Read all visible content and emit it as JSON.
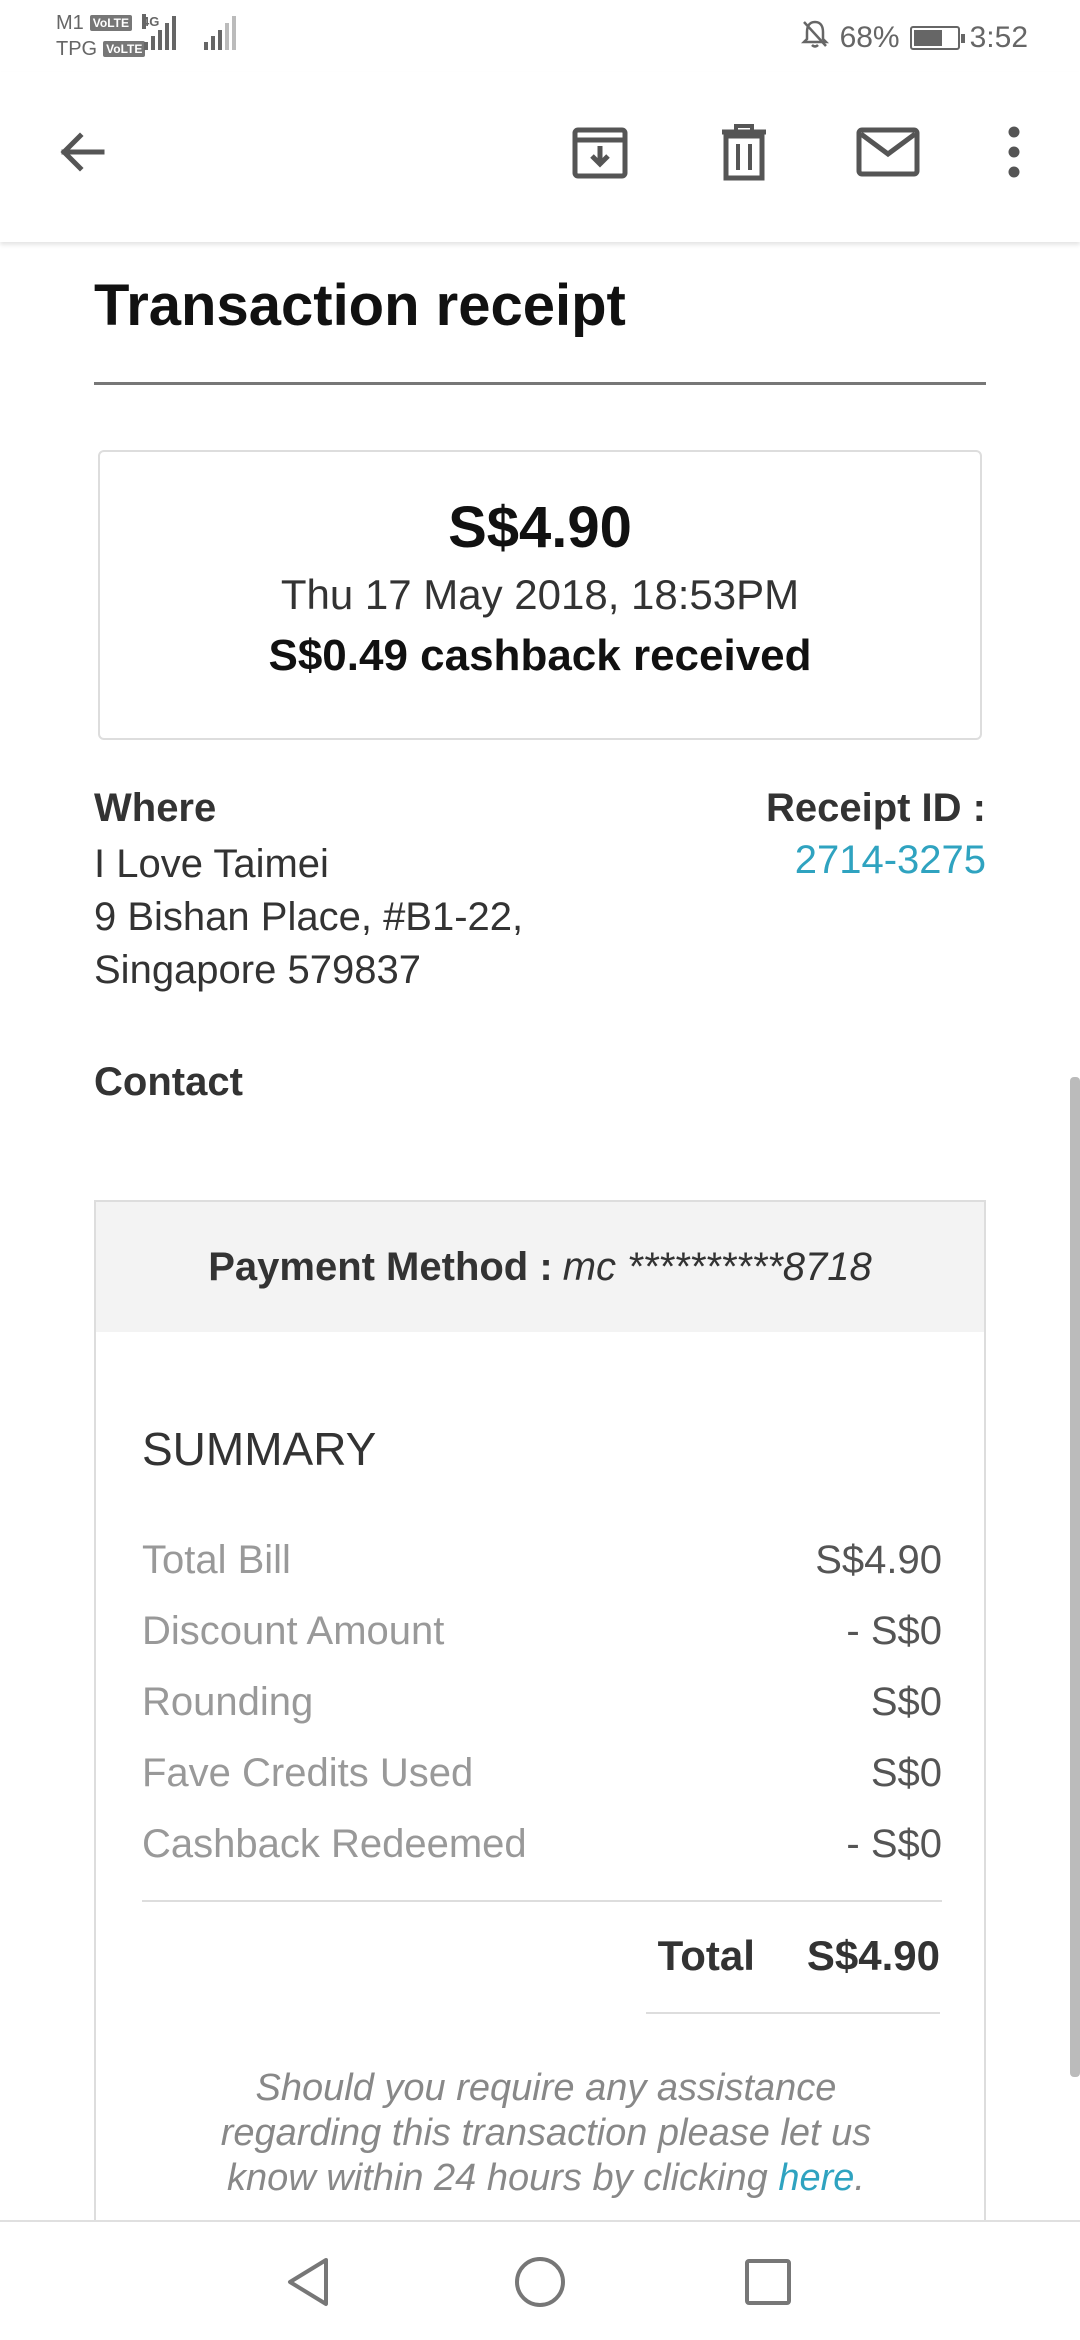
{
  "status_bar": {
    "carrier_1": "M1",
    "carrier_2": "TPG",
    "volte": "VoLTE",
    "network": "4G",
    "battery_percent": "68%",
    "battery_level": 0.68,
    "time": "3:52",
    "icons": [
      "signal-icon",
      "mute-bell-icon",
      "battery-icon"
    ]
  },
  "app_bar": {
    "icons": [
      "back-arrow-icon",
      "archive-icon",
      "trash-icon",
      "mail-icon",
      "more-vert-icon"
    ]
  },
  "receipt": {
    "title": "Transaction receipt",
    "amount": "S$4.90",
    "date": "Thu 17 May 2018, 18:53PM",
    "cashback": "S$0.49 cashback received",
    "where_label": "Where",
    "merchant": "I Love Taimei",
    "address": "9 Bishan Place, #B1-22, Singapore 579837",
    "receipt_id_label": "Receipt ID :",
    "receipt_id": "2714-3275",
    "contact_label": "Contact",
    "payment_label": "Payment Method :",
    "payment_value": "mc **********8718",
    "summary_title": "SUMMARY",
    "summary_rows": [
      {
        "label": "Total Bill",
        "value": "S$4.90"
      },
      {
        "label": "Discount Amount",
        "value": "- S$0"
      },
      {
        "label": "Rounding",
        "value": "S$0"
      },
      {
        "label": "Fave Credits Used",
        "value": "S$0"
      },
      {
        "label": "Cashback Redeemed",
        "value": "- S$0"
      }
    ],
    "total_label": "Total",
    "total_value": "S$4.90",
    "assist_text": "Should you require any assistance regarding this transaction please let us know within 24 hours by clicking",
    "assist_link": "here",
    "assist_end": "."
  },
  "colors": {
    "link": "#2fa3c0",
    "icon": "#555555"
  }
}
